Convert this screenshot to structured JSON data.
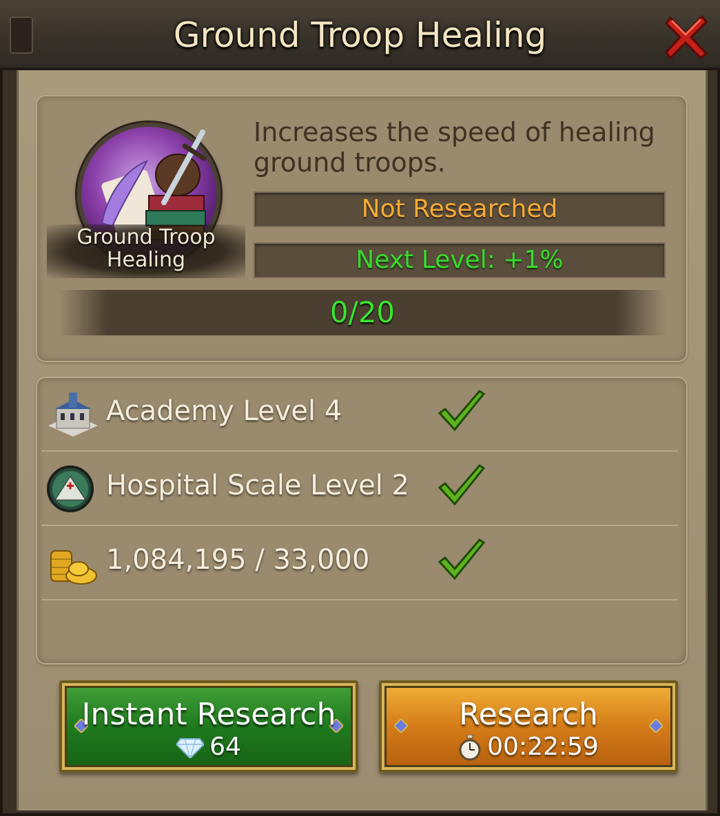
{
  "window": {
    "title": "Ground Troop Healing"
  },
  "research": {
    "icon_label": "Ground Troop Healing",
    "description": "Increases the speed of healing ground troops.",
    "status": "Not Researched",
    "next_level": "Next Level: +1%",
    "progress_text": "0/20",
    "progress_fraction": 0
  },
  "requirements": [
    {
      "icon": "academy-building-icon",
      "label": "Academy Level 4",
      "met": true
    },
    {
      "icon": "hospital-tent-icon",
      "label": "Hospital Scale Level 2",
      "met": true
    },
    {
      "icon": "gold-coins-icon",
      "label": "1,084,195 / 33,000",
      "met": true
    }
  ],
  "buttons": {
    "instant": {
      "label": "Instant Research",
      "cost": "64",
      "cost_icon": "gem-icon"
    },
    "research": {
      "label": "Research",
      "time": "00:22:59",
      "time_icon": "stopwatch-icon"
    }
  },
  "colors": {
    "status_orange": "#f4ab37",
    "next_level_green": "#39d92f",
    "instant_button": "#1f7a1e",
    "research_button": "#d47c18"
  }
}
